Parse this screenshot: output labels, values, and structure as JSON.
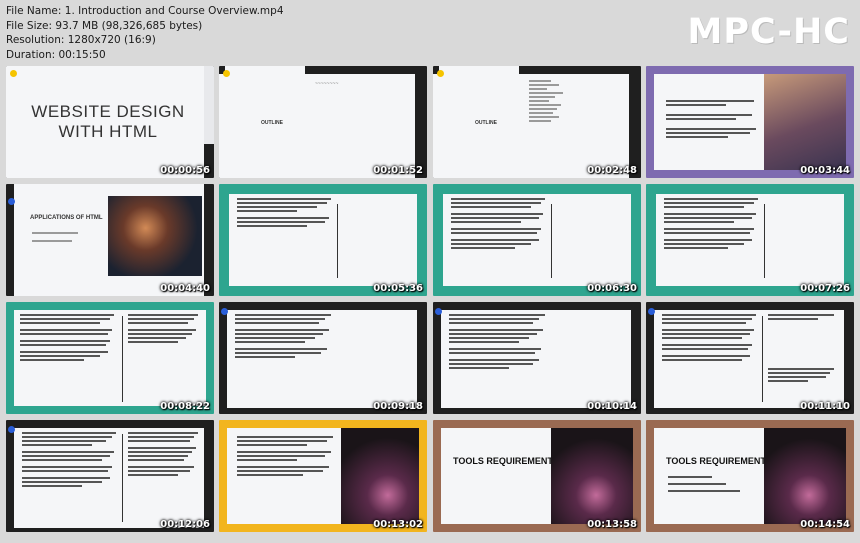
{
  "header": {
    "file_name": "File Name: 1. Introduction and Course Overview.mp4",
    "file_size": "File Size: 93.7 MB (98,326,685 bytes)",
    "resolution": "Resolution: 1280x720 (16:9)",
    "duration": "Duration: 00:15:50"
  },
  "logo": "MPC-HC",
  "colors": {
    "teal": "#2ea58f",
    "purple": "#7e6bb0",
    "dark": "#1f1f1f",
    "yellow": "#f2b51e",
    "brown": "#9a6a52",
    "slide_bg": "#f5f6f8"
  },
  "thumbnails": [
    {
      "time": "00:00:56",
      "title": "WEBSITE DESIGN\nWITH HTML"
    },
    {
      "time": "00:01:52",
      "label": "OUTLINE"
    },
    {
      "time": "00:02:48",
      "label": "OUTLINE"
    },
    {
      "time": "00:03:44"
    },
    {
      "time": "00:04:40",
      "title": "APPLICATIONS OF HTML"
    },
    {
      "time": "00:05:36"
    },
    {
      "time": "00:06:30"
    },
    {
      "time": "00:07:26"
    },
    {
      "time": "00:08:22"
    },
    {
      "time": "00:09:18"
    },
    {
      "time": "00:10:14"
    },
    {
      "time": "00:11:10"
    },
    {
      "time": "00:12:06"
    },
    {
      "time": "00:13:02"
    },
    {
      "time": "00:13:58",
      "title": "TOOLS REQUIREMENT"
    },
    {
      "time": "00:14:54",
      "title": "TOOLS REQUIREMENT"
    }
  ]
}
